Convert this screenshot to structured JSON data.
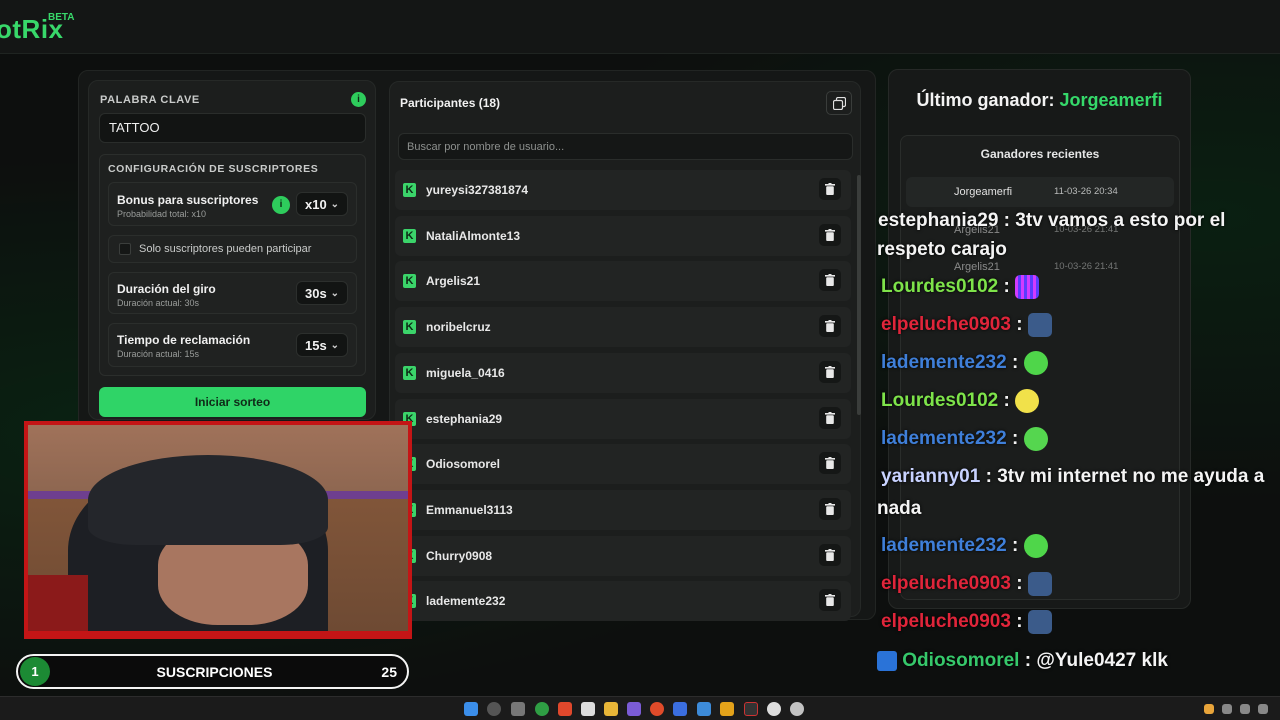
{
  "app": {
    "logo": "otRix",
    "beta": "BETA"
  },
  "keyword": {
    "label": "PALABRA CLAVE",
    "value": "TATTOO",
    "info": "i"
  },
  "subscribers": {
    "section_label": "CONFIGURACIÓN DE SUSCRIPTORES",
    "bonus": {
      "title": "Bonus para suscriptores",
      "sub": "Probabilidad total: x10",
      "value": "x10"
    },
    "only_subs": {
      "label": "Solo suscriptores pueden participar"
    },
    "duration": {
      "title": "Duración del giro",
      "sub": "Duración actual: 30s",
      "value": "30s"
    },
    "claim": {
      "title": "Tiempo de reclamación",
      "sub": "Duración actual: 15s",
      "value": "15s"
    }
  },
  "start_button": "Iniciar sorteo",
  "participants": {
    "title": "Participantes (18)",
    "search_placeholder": "Buscar por nombre de usuario...",
    "list": [
      "yureysi327381874",
      "NataliAlmonte13",
      "Argelis21",
      "noribelcruz",
      "miguela_0416",
      "estephania29",
      "Odiosomorel",
      "Emmanuel3113",
      "Churry0908",
      "lademente232"
    ]
  },
  "winner": {
    "label": "Último ganador:",
    "name": "Jorgeamerfi",
    "recent_title": "Ganadores recientes",
    "recent": [
      {
        "name": "Jorgeamerfi",
        "date": "11-03-26 20:34"
      },
      {
        "name": "Argelis21",
        "date": "10-03-26 21:41"
      },
      {
        "name": "Argelis21",
        "date": "10-03-26 21:41"
      }
    ]
  },
  "chat": [
    {
      "user": "estephania29",
      "msg": "3tv vamos a esto por el",
      "color": "#f4f4f4"
    },
    {
      "user": "",
      "msg": "respeto carajo",
      "color": "#f4f4f4"
    },
    {
      "user": "Lourdes0102",
      "msg": "",
      "color": "#7ee34a"
    },
    {
      "user": "elpeluche0903",
      "msg": "",
      "color": "#e0253a"
    },
    {
      "user": "lademente232",
      "msg": "",
      "color": "#3f7fd9"
    },
    {
      "user": "Lourdes0102",
      "msg": "",
      "color": "#7ee34a"
    },
    {
      "user": "lademente232",
      "msg": "",
      "color": "#3f7fd9"
    },
    {
      "user": "yarianny01",
      "msg": "3tv mi internet no me ayuda a",
      "color": "#c8d2ff"
    },
    {
      "user": "",
      "msg": "nada",
      "color": "#f4f4f4"
    },
    {
      "user": "lademente232",
      "msg": "",
      "color": "#3f7fd9"
    },
    {
      "user": "elpeluche0903",
      "msg": "",
      "color": "#e0253a"
    },
    {
      "user": "elpeluche0903",
      "msg": "",
      "color": "#e0253a"
    },
    {
      "user": "Odiosomorel",
      "msg": "@Yule0427 klk",
      "color": "#36c86b"
    }
  ],
  "sub_goal": {
    "current": "1",
    "label": "SUSCRIPCIONES",
    "total": "25"
  }
}
